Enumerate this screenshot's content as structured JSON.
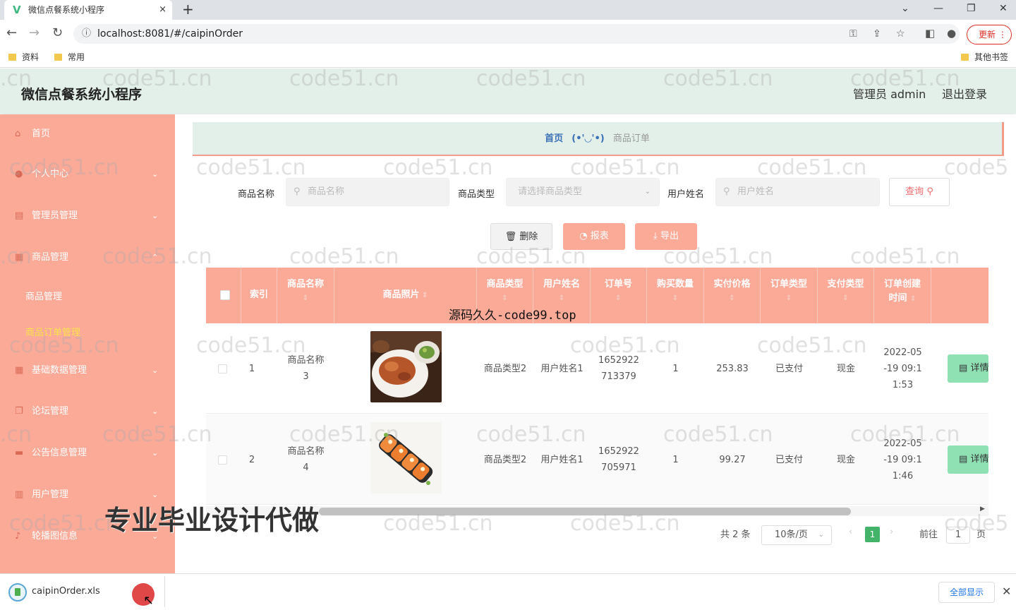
{
  "browser": {
    "tab_title": "微信点餐系统小程序",
    "tab_close": "×",
    "new_tab": "+",
    "address": "localhost:8081/#/caipinOrder",
    "update_label": "更新",
    "bookmarks": [
      "资料",
      "常用"
    ],
    "other_bookmarks": "其他书签"
  },
  "header": {
    "title": "微信点餐系统小程序",
    "admin": "管理员 admin",
    "logout": "退出登录"
  },
  "sidebar": {
    "items": [
      {
        "label": "首页",
        "icon": "home-icon"
      },
      {
        "label": "个人中心",
        "icon": "user-icon"
      },
      {
        "label": "管理员管理",
        "icon": "list-icon"
      },
      {
        "label": "商品管理",
        "icon": "grid-icon"
      },
      {
        "label": "基础数据管理",
        "icon": "grid-icon"
      },
      {
        "label": "论坛管理",
        "icon": "copy-icon"
      },
      {
        "label": "公告信息管理",
        "icon": "chat-icon"
      },
      {
        "label": "用户管理",
        "icon": "chart-icon"
      },
      {
        "label": "轮播图信息",
        "icon": "mic-icon"
      }
    ],
    "sub_items": [
      "商品管理",
      "商品订单管理"
    ]
  },
  "breadcrumb": {
    "home": "首页",
    "face": "(•'◡'•)",
    "current": "商品订单"
  },
  "search": {
    "name_label": "商品名称",
    "name_placeholder": "商品名称",
    "type_label": "商品类型",
    "type_placeholder": "请选择商品类型",
    "user_label": "用户姓名",
    "user_placeholder": "用户姓名",
    "query_label": "查询"
  },
  "actions": {
    "delete": "删除",
    "report": "报表",
    "export": "导出"
  },
  "table": {
    "headers": [
      "索引",
      "商品名称",
      "商品照片",
      "商品类型",
      "用户姓名",
      "订单号",
      "购买数量",
      "实付价格",
      "订单类型",
      "支付类型",
      "订单创建时间"
    ],
    "rows": [
      {
        "index": "1",
        "name": "商品名称3",
        "type": "商品类型2",
        "user": "用户姓名1",
        "order_no": "1652922713379",
        "qty": "1",
        "price": "253.83",
        "order_type": "已支付",
        "pay_type": "现金",
        "created": "2022-05-19 09:11:53",
        "detail": "详情"
      },
      {
        "index": "2",
        "name": "商品名称4",
        "type": "商品类型2",
        "user": "用户姓名1",
        "order_no": "1652922705971",
        "qty": "1",
        "price": "99.27",
        "order_type": "已支付",
        "pay_type": "现金",
        "created": "2022-05-19 09:11:46",
        "detail": "详情"
      }
    ]
  },
  "pagination": {
    "total": "共 2 条",
    "page_size": "10条/页",
    "current": "1",
    "goto": "前往",
    "goto_value": "1",
    "page_unit": "页"
  },
  "watermarks": {
    "site": "code51.cn",
    "code99": "源码久久-code99.top",
    "ad": "专业毕业设计代做"
  },
  "download": {
    "file": "caipinOrder.xls",
    "show_all": "全部显示"
  },
  "colors": {
    "sidebar": "#fbaa98",
    "header_bg": "#e3f0ea",
    "accent": "#f56c6c",
    "detail_btn": "#8fe1b4",
    "active_page": "#43b36a"
  }
}
